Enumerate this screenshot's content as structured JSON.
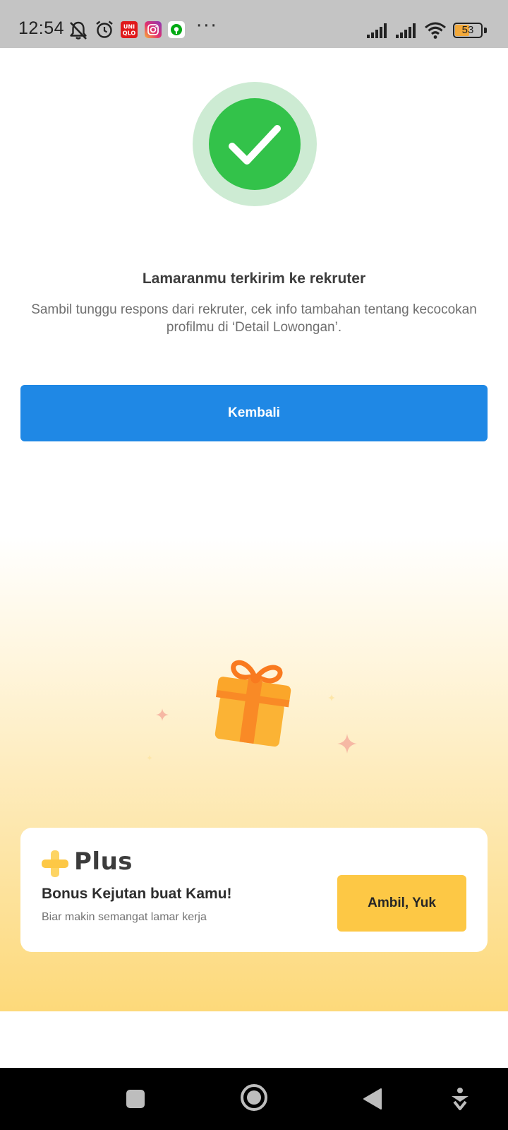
{
  "status_bar": {
    "time": "12:54",
    "battery": "53",
    "icons": [
      "mute-notification-icon",
      "alarm-icon",
      "uniqlo-app-icon",
      "instagram-app-icon",
      "gojek-app-icon",
      "more-dots-icon",
      "signal-icon",
      "signal-icon",
      "wifi-icon",
      "battery-icon"
    ],
    "uniqlo_top": "UNI",
    "uniqlo_bottom": "QLO",
    "more": "···"
  },
  "success": {
    "icon": "check-circle-icon",
    "title": "Lamaranmu terkirim ke rekruter",
    "description": "Sambil tunggu respons dari rekruter, cek info tambahan tentang kecocokan profilmu di ‘Detail Lowongan’.",
    "button_label": "Kembali"
  },
  "promo": {
    "illustration": "gift-icon",
    "logo_text": "Plus",
    "title": "Bonus Kejutan buat Kamu!",
    "subtitle": "Biar makin semangat lamar kerja",
    "button_label": "Ambil, Yuk"
  },
  "nav_bar": {
    "buttons": [
      "recents-square-icon",
      "home-circle-icon",
      "back-triangle-icon",
      "accessibility-icon"
    ]
  },
  "colors": {
    "primary_button": "#1f88e5",
    "success_green": "#33c24a",
    "promo_button": "#fdc845",
    "gift_orange": "#fba62a"
  }
}
